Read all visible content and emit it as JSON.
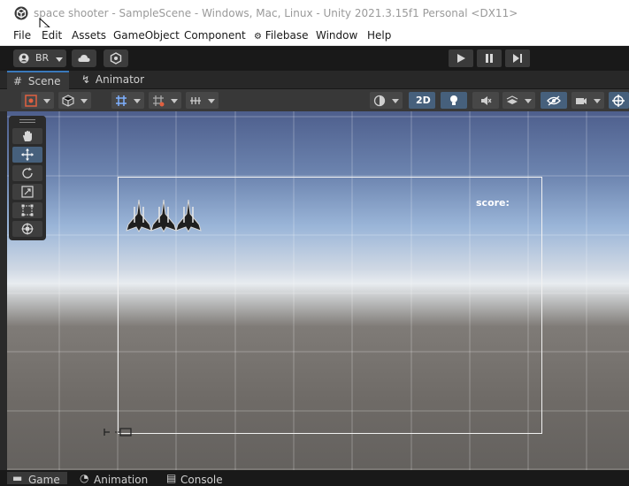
{
  "window": {
    "title": "space shooter - SampleScene - Windows, Mac, Linux - Unity 2021.3.15f1 Personal <DX11>"
  },
  "menu": [
    "File",
    "Edit",
    "Assets",
    "GameObject",
    "Component",
    "Filebase",
    "Window",
    "Help"
  ],
  "toolbar": {
    "account_label": "BR"
  },
  "tabs": [
    "Scene",
    "Animator"
  ],
  "scene_toolbar": {
    "mode_2d_label": "2D"
  },
  "tools": [
    "hand-tool",
    "move-tool",
    "rotate-tool",
    "scale-tool",
    "rect-tool",
    "transform-tool"
  ],
  "scene": {
    "score_label": "score:"
  },
  "bottom_tabs": [
    "Game",
    "Animation",
    "Console"
  ],
  "colors": {
    "accent": "#3a79bb",
    "active_tool": "#46607c",
    "toolbar_bg": "#383838"
  }
}
